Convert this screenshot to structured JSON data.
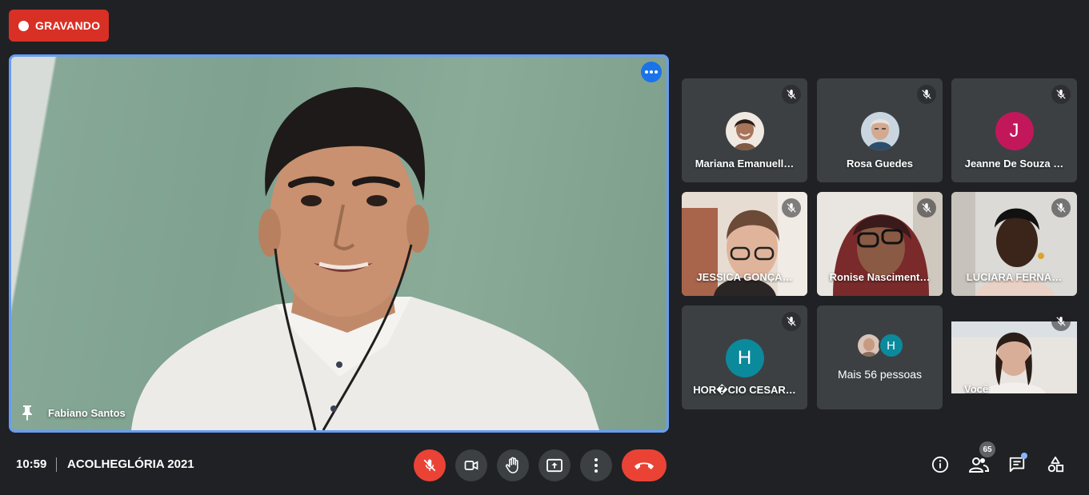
{
  "recording": {
    "label": "GRAVANDO",
    "color": "#d93025"
  },
  "main": {
    "speaker_name": "Fabiano Santos",
    "border_color": "#669df6"
  },
  "participants": [
    {
      "name": "Mariana Emanuell…",
      "type": "photo"
    },
    {
      "name": "Rosa Guedes",
      "type": "photo"
    },
    {
      "name": "Jeanne De Souza …",
      "type": "letter",
      "letter": "J",
      "color": "#c2185b"
    },
    {
      "name": "JESSICA GONÇA…",
      "type": "video"
    },
    {
      "name": "Ronise Nasciment…",
      "type": "video"
    },
    {
      "name": "LUCIARA FERNA…",
      "type": "video"
    },
    {
      "name": "HOR�CIO CESAR…",
      "type": "letter",
      "letter": "H",
      "color": "#0b8a9c"
    }
  ],
  "more_people": {
    "label": "Mais 56 pessoas",
    "letter": "H"
  },
  "self_tile": {
    "name": "Você"
  },
  "bottom": {
    "time": "10:59",
    "meeting_title": "ACOLHEGLÓRIA 2021",
    "participant_count": "65"
  },
  "icons": {
    "mic": "mic-off-icon",
    "camera": "camera-icon",
    "hand": "raise-hand-icon",
    "present": "present-screen-icon",
    "more": "more-vert-icon",
    "hangup": "hangup-icon",
    "info": "info-icon",
    "people": "people-icon",
    "chat": "chat-icon",
    "activities": "activities-icon"
  }
}
